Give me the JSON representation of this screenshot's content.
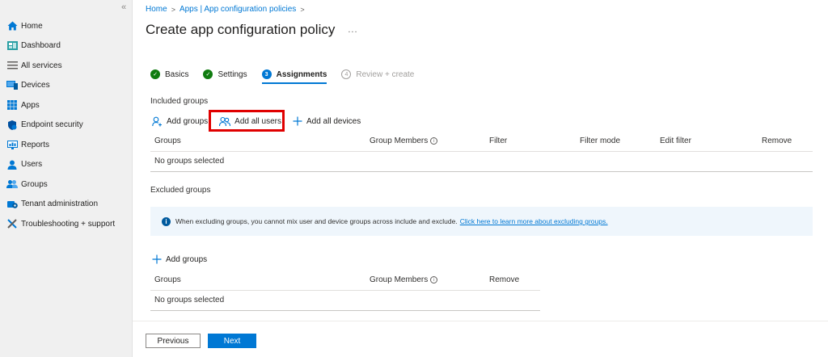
{
  "sidebar": {
    "collapse_glyph": "«",
    "items": [
      {
        "label": "Home",
        "icon": "home-icon",
        "color": "#0078d4"
      },
      {
        "label": "Dashboard",
        "icon": "dashboard-icon",
        "color": "#2aa0a4"
      },
      {
        "label": "All services",
        "icon": "list-icon",
        "color": "#605e5c"
      },
      {
        "label": "Devices",
        "icon": "devices-icon",
        "color": "#0078d4"
      },
      {
        "label": "Apps",
        "icon": "apps-icon",
        "color": "#0078d4"
      },
      {
        "label": "Endpoint security",
        "icon": "shield-icon",
        "color": "#0050a0"
      },
      {
        "label": "Reports",
        "icon": "reports-icon",
        "color": "#0078d4"
      },
      {
        "label": "Users",
        "icon": "user-icon",
        "color": "#0078d4"
      },
      {
        "label": "Groups",
        "icon": "groups-icon",
        "color": "#0078d4"
      },
      {
        "label": "Tenant administration",
        "icon": "gear-icon",
        "color": "#0078d4"
      },
      {
        "label": "Troubleshooting + support",
        "icon": "tools-icon",
        "color": "#0078d4"
      }
    ]
  },
  "breadcrumb": {
    "home": "Home",
    "parent": "Apps | App configuration policies",
    "sep": ">"
  },
  "page": {
    "title": "Create app configuration policy",
    "more": "..."
  },
  "steps": [
    {
      "label": "Basics",
      "state": "done",
      "mark": "✓"
    },
    {
      "label": "Settings",
      "state": "done",
      "mark": "✓"
    },
    {
      "label": "Assignments",
      "state": "active",
      "mark": "3"
    },
    {
      "label": "Review + create",
      "state": "pending",
      "mark": "4"
    }
  ],
  "included": {
    "heading": "Included groups",
    "add_groups": "Add groups",
    "add_all_users": "Add all users",
    "add_all_devices": "Add all devices",
    "columns": [
      "Groups",
      "Group Members",
      "Filter",
      "Filter mode",
      "Edit filter",
      "Remove"
    ],
    "empty": "No groups selected"
  },
  "excluded": {
    "heading": "Excluded groups",
    "info_text": "When excluding groups, you cannot mix user and device groups across include and exclude.",
    "info_link": "Click here to learn more about excluding groups.",
    "add_groups": "Add groups",
    "columns": [
      "Groups",
      "Group Members",
      "Remove"
    ],
    "empty": "No groups selected"
  },
  "footer": {
    "previous": "Previous",
    "next": "Next"
  },
  "colors": {
    "accent": "#0078d4",
    "success": "#107c10",
    "highlight": "#e00000"
  }
}
